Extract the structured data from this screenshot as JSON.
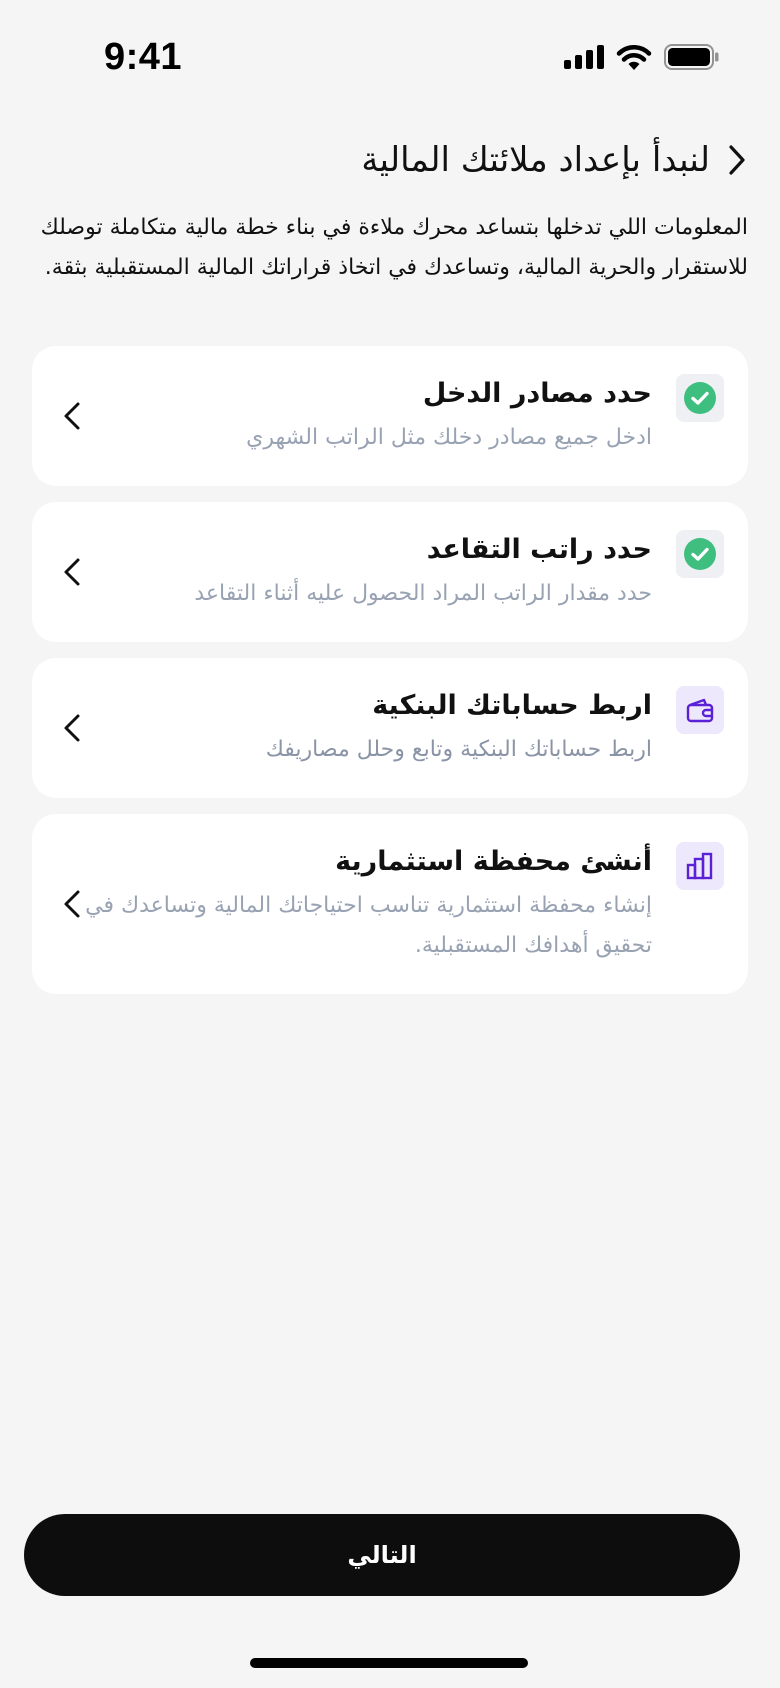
{
  "status_bar": {
    "time": "9:41"
  },
  "header": {
    "title": "لنبدأ بإعداد ملائتك المالية",
    "intro": "المعلومات اللي تدخلها بتساعد محرك ملاءة في بناء خطة مالية متكاملة توصلك للاستقرار والحرية المالية، وتساعدك في اتخاذ قراراتك المالية المستقبلية بثقة."
  },
  "steps": [
    {
      "title": "حدد مصادر الدخل",
      "description": "ادخل جميع مصادر دخلك مثل الراتب الشهري",
      "status": "done",
      "icon": "check-circle-icon"
    },
    {
      "title": "حدد راتب التقاعد",
      "description": "حدد مقدار الراتب المراد الحصول عليه أثناء التقاعد",
      "status": "done",
      "icon": "check-circle-icon"
    },
    {
      "title": "اربط حساباتك البنكية",
      "description": "اربط حساباتك البنكية وتابع وحلل مصاريفك",
      "status": "todo",
      "icon": "wallet-icon"
    },
    {
      "title": "أنشئ محفظة استثمارية",
      "description": "إنشاء محفظة استثمارية تناسب احتياجاتك المالية وتساعدك في تحقيق أهدافك المستقبلية.",
      "status": "todo",
      "icon": "bar-chart-icon"
    }
  ],
  "footer": {
    "next_label": "التالي"
  },
  "colors": {
    "accent": "#5b21d6",
    "success": "#3fbf7f",
    "muted_text": "#98a2b3",
    "button": "#0d0d0d"
  }
}
